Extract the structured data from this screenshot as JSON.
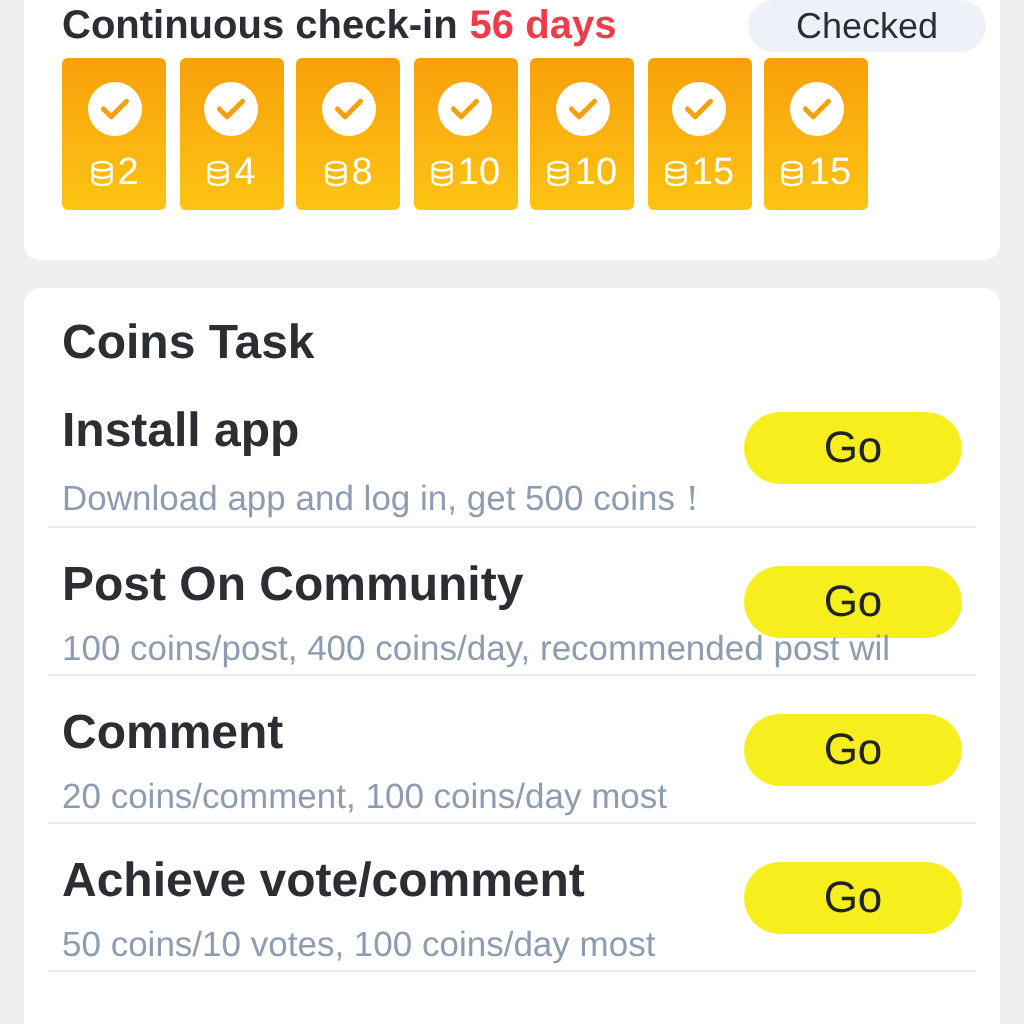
{
  "checkin": {
    "label": "Continuous check-in",
    "streak": "56 days",
    "button": "Checked",
    "days": [
      {
        "coins": "2",
        "checked": true
      },
      {
        "coins": "4",
        "checked": true
      },
      {
        "coins": "8",
        "checked": true
      },
      {
        "coins": "10",
        "checked": true
      },
      {
        "coins": "10",
        "checked": true
      },
      {
        "coins": "15",
        "checked": true
      },
      {
        "coins": "15",
        "checked": true
      }
    ]
  },
  "tasks": {
    "title": "Coins Task",
    "items": [
      {
        "name": "Install app",
        "description": "Download app and log in, get 500 coins！",
        "button": "Go"
      },
      {
        "name": "Post On Community",
        "description": "100 coins/post, 400 coins/day, recommended post wil",
        "button": "Go"
      },
      {
        "name": "Comment",
        "description": "20 coins/comment, 100 coins/day most",
        "button": "Go"
      },
      {
        "name": "Achieve vote/comment",
        "description": "50 coins/10 votes, 100 coins/day most",
        "button": "Go"
      }
    ]
  }
}
